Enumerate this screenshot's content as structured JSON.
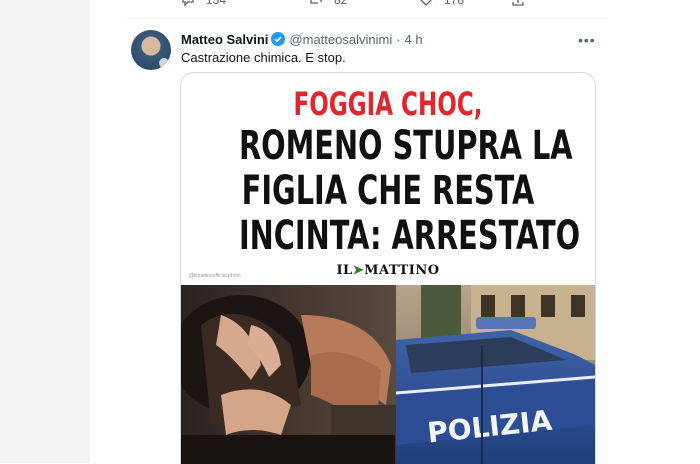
{
  "prev_tweet": {
    "actions": [
      {
        "icon": "reply-icon",
        "count": "134"
      },
      {
        "icon": "retweet-icon",
        "count": "82"
      },
      {
        "icon": "like-icon",
        "count": "178"
      },
      {
        "icon": "share-icon",
        "count": ""
      }
    ]
  },
  "tweet": {
    "author_name": "Matteo Salvini",
    "handle": "@matteosalvinimi",
    "separator": "·",
    "time": "4 h",
    "text": "Castrazione chimica. E stop.",
    "verified_color": "#1d9bf0"
  },
  "media": {
    "headline_1": "FOGGIA CHOC,",
    "headline_2": "ROMENO STUPRA LA",
    "headline_3": "FIGLIA CHE RESTA",
    "headline_4": "INCINTA: ARRESTATO",
    "logo_prefix": "IL",
    "logo_suffix": "MATTINO",
    "credit": "@ilmattinoofficial.photo",
    "car_text": "POLIZIA",
    "headline_accent": "#e3262c"
  }
}
